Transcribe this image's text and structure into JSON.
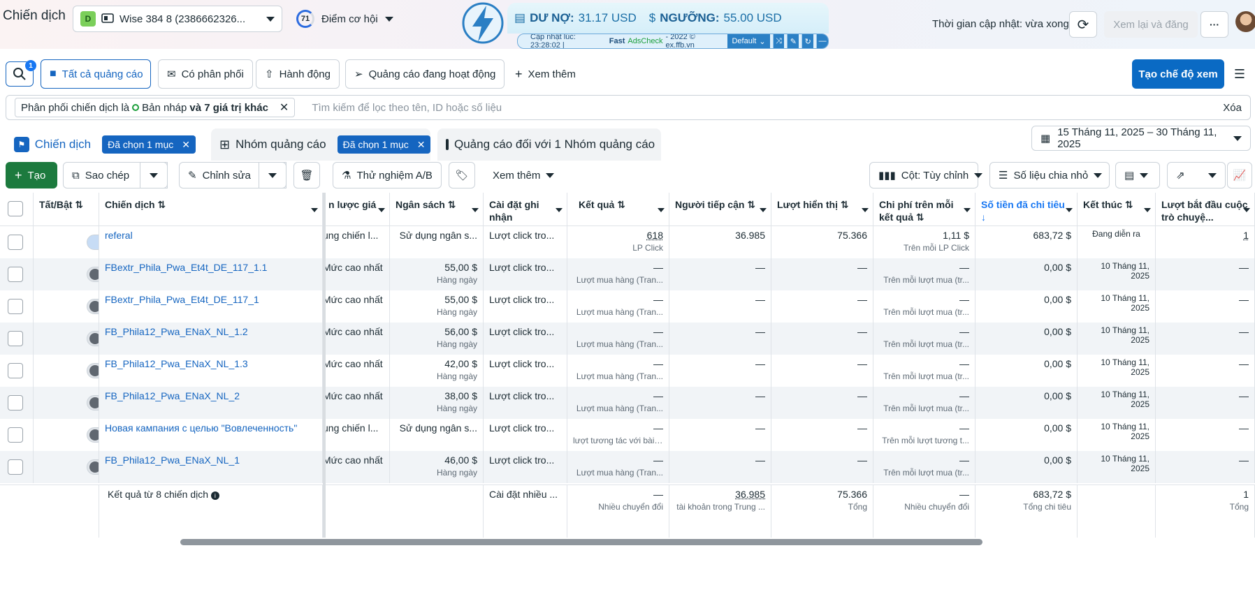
{
  "header": {
    "title": "Chiến dịch",
    "account": {
      "badge": "D",
      "name": "Wise 384 8 (2386662326..."
    },
    "score": {
      "value": "71",
      "label": "Điểm cơ hội"
    },
    "extension": {
      "debt_label": "DƯ NỢ:",
      "debt_value": "31.17 USD",
      "threshold_label": "NGƯỠNG:",
      "threshold_value": "55.00 USD",
      "updated_prefix": "Cập nhật lúc: 23:28:02 |",
      "brand_fast": "Fast",
      "brand_name": "AdsCheck",
      "brand_suffix": "- 2022 © ex.ffb.vn",
      "preset": "Default"
    },
    "update_time": "Thời gian cập nhật: vừa xong",
    "review_button": "Xem lại và đăng",
    "more": "···"
  },
  "filters_row": {
    "search_badge": "1",
    "items": [
      {
        "label": "Tất cả quảng cáo"
      },
      {
        "label": "Có phân phối"
      },
      {
        "label": "Hành động"
      },
      {
        "label": "Quảng cáo đang hoạt động"
      },
      {
        "label": "Xem thêm"
      }
    ],
    "create_view": "Tạo chế độ xem"
  },
  "filter_bar": {
    "chip_prefix": "Phân phối chiến dịch là",
    "chip_value": "Bản nháp",
    "chip_more": "và 7 giá trị khác",
    "placeholder": "Tìm kiếm để lọc theo tên, ID hoặc số liệu",
    "clear": "Xóa"
  },
  "tabs": {
    "campaigns": {
      "label": "Chiến dịch",
      "selected": "Đã chọn 1 mục"
    },
    "adsets": {
      "label": "Nhóm quảng cáo",
      "selected": "Đã chọn 1 mục"
    },
    "ads": {
      "label": "Quảng cáo đối với 1 Nhóm quảng cáo"
    },
    "date_range": "15 Tháng 11, 2025 – 30 Tháng 11, 2025"
  },
  "toolbar": {
    "create": "Tạo",
    "duplicate": "Sao chép",
    "edit": "Chỉnh sửa",
    "ab_test": "Thử nghiệm A/B",
    "more": "Xem thêm",
    "columns": "Cột: Tùy chỉnh",
    "breakdown": "Số liệu chia nhỏ"
  },
  "table": {
    "headers": {
      "toggle": "Tất/Bật ⇅",
      "name": "Chiến dịch ⇅",
      "bid": "n lược giá",
      "budget": "Ngân sách ⇅",
      "attribution": "Cài đặt ghi nhận",
      "results": "Kết quả ⇅",
      "reach": "Người tiếp cận ⇅",
      "impressions": "Lượt hiển thị ⇅",
      "cost": "Chi phí trên mỗi kết quả ⇅",
      "spent": "Số tiền đã chi tiêu ↓",
      "ends": "Kết thúc ⇅",
      "conv": "Lượt bắt đầu cuộc trò chuyệ..."
    },
    "rows": [
      {
        "on": true,
        "name": "referal",
        "bid": "ụng chiến l...",
        "budget": "Sử dụng ngân s...",
        "budget_sub": "",
        "attr": "Lượt click tro...",
        "result": "618",
        "result_sub": "LP Click",
        "reach": "36.985",
        "impr": "75.366",
        "cost": "1,11 $",
        "cost_sub": "Trên mỗi LP Click",
        "spent": "683,72 $",
        "ends": "Đang diễn ra",
        "ends2": "",
        "conv": "1"
      },
      {
        "on": false,
        "name": "FBextr_Phila_Pwa_Et4t_DE_117_1.1",
        "bid": "Mức cao nhất",
        "budget": "55,00 $",
        "budget_sub": "Hàng ngày",
        "attr": "Lượt click tro...",
        "result": "—",
        "result_sub": "Lượt mua hàng (Tran...",
        "reach": "—",
        "impr": "—",
        "cost": "—",
        "cost_sub": "Trên mỗi lượt mua (tr...",
        "spent": "0,00 $",
        "ends": "10 Tháng 11,",
        "ends2": "2025",
        "conv": "—"
      },
      {
        "on": false,
        "name": "FBextr_Phila_Pwa_Et4t_DE_117_1",
        "bid": "Mức cao nhất",
        "budget": "55,00 $",
        "budget_sub": "Hàng ngày",
        "attr": "Lượt click tro...",
        "result": "—",
        "result_sub": "Lượt mua hàng (Tran...",
        "reach": "—",
        "impr": "—",
        "cost": "—",
        "cost_sub": "Trên mỗi lượt mua (tr...",
        "spent": "0,00 $",
        "ends": "10 Tháng 11,",
        "ends2": "2025",
        "conv": "—"
      },
      {
        "on": false,
        "name": "FB_Phila12_Pwa_ENaX_NL_1.2",
        "bid": "Mức cao nhất",
        "budget": "56,00 $",
        "budget_sub": "Hàng ngày",
        "attr": "Lượt click tro...",
        "result": "—",
        "result_sub": "Lượt mua hàng (Tran...",
        "reach": "—",
        "impr": "—",
        "cost": "—",
        "cost_sub": "Trên mỗi lượt mua (tr...",
        "spent": "0,00 $",
        "ends": "10 Tháng 11,",
        "ends2": "2025",
        "conv": "—"
      },
      {
        "on": false,
        "name": "FB_Phila12_Pwa_ENaX_NL_1.3",
        "bid": "Mức cao nhất",
        "budget": "42,00 $",
        "budget_sub": "Hàng ngày",
        "attr": "Lượt click tro...",
        "result": "—",
        "result_sub": "Lượt mua hàng (Tran...",
        "reach": "—",
        "impr": "—",
        "cost": "—",
        "cost_sub": "Trên mỗi lượt mua (tr...",
        "spent": "0,00 $",
        "ends": "10 Tháng 11,",
        "ends2": "2025",
        "conv": "—"
      },
      {
        "on": false,
        "name": "FB_Phila12_Pwa_ENaX_NL_2",
        "bid": "Mức cao nhất",
        "budget": "38,00 $",
        "budget_sub": "Hàng ngày",
        "attr": "Lượt click tro...",
        "result": "—",
        "result_sub": "Lượt mua hàng (Tran...",
        "reach": "—",
        "impr": "—",
        "cost": "—",
        "cost_sub": "Trên mỗi lượt mua (tr...",
        "spent": "0,00 $",
        "ends": "10 Tháng 11,",
        "ends2": "2025",
        "conv": "—"
      },
      {
        "on": false,
        "name": "Новая кампания с целью \"Вовлеченность\"",
        "bid": "ụng chiến l...",
        "budget": "Sử dụng ngân s...",
        "budget_sub": "",
        "attr": "Lượt click tro...",
        "result": "—",
        "result_sub": "lượt tương tác với bài ...",
        "reach": "—",
        "impr": "—",
        "cost": "—",
        "cost_sub": "Trên mỗi lượt tương t...",
        "spent": "0,00 $",
        "ends": "10 Tháng 11,",
        "ends2": "2025",
        "conv": "—"
      },
      {
        "on": false,
        "name": "FB_Phila12_Pwa_ENaX_NL_1",
        "bid": "Mức cao nhất",
        "budget": "46,00 $",
        "budget_sub": "Hàng ngày",
        "attr": "Lượt click tro...",
        "result": "—",
        "result_sub": "Lượt mua hàng (Tran...",
        "reach": "—",
        "impr": "—",
        "cost": "—",
        "cost_sub": "Trên mỗi lượt mua (tr...",
        "spent": "0,00 $",
        "ends": "10 Tháng 11,",
        "ends2": "2025",
        "conv": "—"
      }
    ],
    "totals": {
      "label": "Kết quả từ 8 chiến dịch",
      "attr": "Cài đặt nhiều ...",
      "result": "—",
      "result_sub": "Nhiều chuyển đổi",
      "reach": "36.985",
      "reach_sub": "tài khoản trong Trung ...",
      "impr": "75.366",
      "impr_sub": "Tổng",
      "cost": "—",
      "cost_sub": "Nhiều chuyển đổi",
      "spent": "683,72 $",
      "spent_sub": "Tổng chi tiêu",
      "conv": "1",
      "conv_sub": "Tổng"
    }
  },
  "colors": {
    "accent": "#1565c0",
    "create": "#1c7a3e",
    "primary_btn": "#0a6ac4"
  }
}
